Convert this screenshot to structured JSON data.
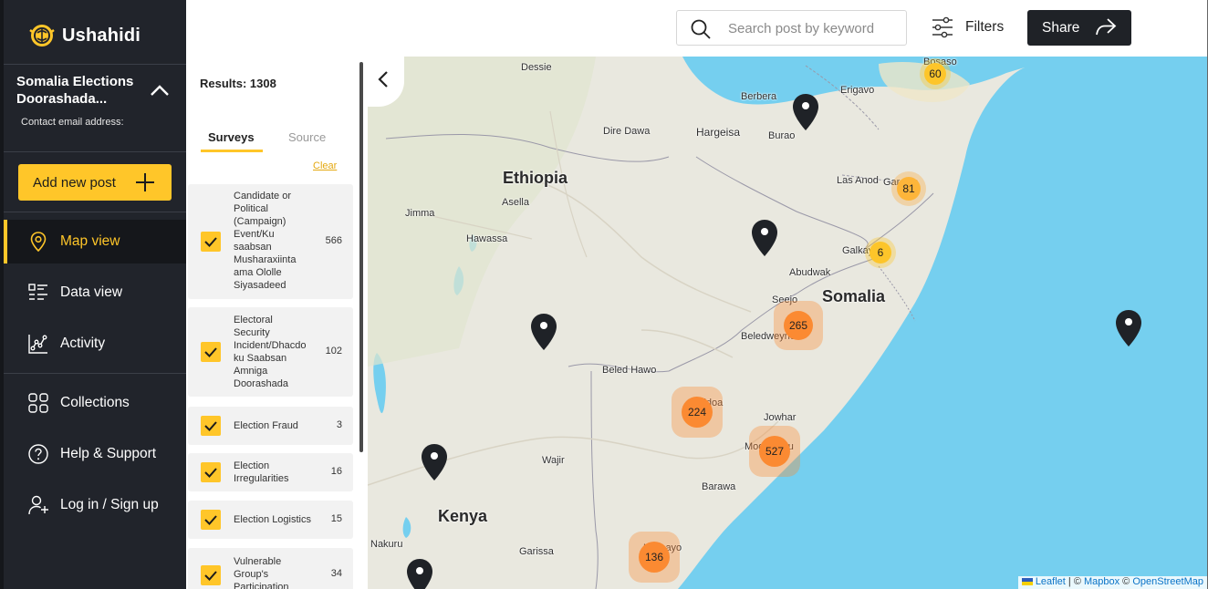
{
  "app": {
    "name": "Ushahidi"
  },
  "deployment": {
    "title": "Somalia Elections Doorashada...",
    "email_label": "Contact email address:"
  },
  "sidebar": {
    "add_post_label": "Add new post",
    "nav": [
      {
        "label": "Map view",
        "icon": "map-pin-icon",
        "active": true
      },
      {
        "label": "Data view",
        "icon": "list-icon"
      },
      {
        "label": "Activity",
        "icon": "activity-chart-icon"
      },
      {
        "label": "Collections",
        "icon": "collections-grid-icon"
      },
      {
        "label": "Help & Support",
        "icon": "help-icon"
      },
      {
        "label": "Log in / Sign up",
        "icon": "add-user-icon"
      }
    ]
  },
  "topbar": {
    "search_placeholder": "Search post by keyword",
    "filters_label": "Filters",
    "share_label": "Share"
  },
  "filters_panel": {
    "results": "Results: 1308",
    "tabs": [
      "Surveys",
      "Source"
    ],
    "clear_label": "Clear",
    "surveys": [
      {
        "label": "Candidate or Political (Campaign) Event/Ku saabsan Musharaxiinta ama Ololle Siyasadeed",
        "count": "566",
        "checked": true
      },
      {
        "label": "Electoral Security Incident/Dhacdo ku Saabsan Amniga Doorashada",
        "count": "102",
        "checked": true
      },
      {
        "label": "Election Fraud",
        "count": "3",
        "checked": true
      },
      {
        "label": "Election Irregularities",
        "count": "16",
        "checked": true
      },
      {
        "label": "Election Logistics",
        "count": "15",
        "checked": true
      },
      {
        "label": "Vulnerable Group's Participation",
        "count": "34",
        "checked": true
      }
    ]
  },
  "map": {
    "countries": [
      "Ethiopia",
      "Somalia",
      "Kenya"
    ],
    "places": [
      "Dessie",
      "Berbera",
      "Erigavo",
      "Bosaso",
      "Dire Dawa",
      "Hargeisa",
      "Burao",
      "Las Anod",
      "Garowe",
      "Jimma",
      "Asella",
      "Hawassa",
      "Galkayo",
      "Abudwak",
      "Seejo",
      "Beledweyne",
      "Beled Hawo",
      "Baidoa",
      "Jowhar",
      "Mogadishu",
      "Wajir",
      "Barawa",
      "Nakuru",
      "Garissa",
      "Kismayo"
    ],
    "clusters": [
      "60",
      "81",
      "6",
      "265",
      "224",
      "527",
      "136"
    ],
    "colors": {
      "water": "#75cfef",
      "land": "#e9e8df",
      "cluster_yellow": "#fdc52a",
      "cluster_orange": "#fb8a32",
      "accent": "#ffc629"
    },
    "attribution": {
      "leaflet": "Leaflet",
      "mapbox": "Mapbox",
      "osm": "OpenStreetMap",
      "sep1": " | © ",
      "sep2": " © "
    }
  }
}
